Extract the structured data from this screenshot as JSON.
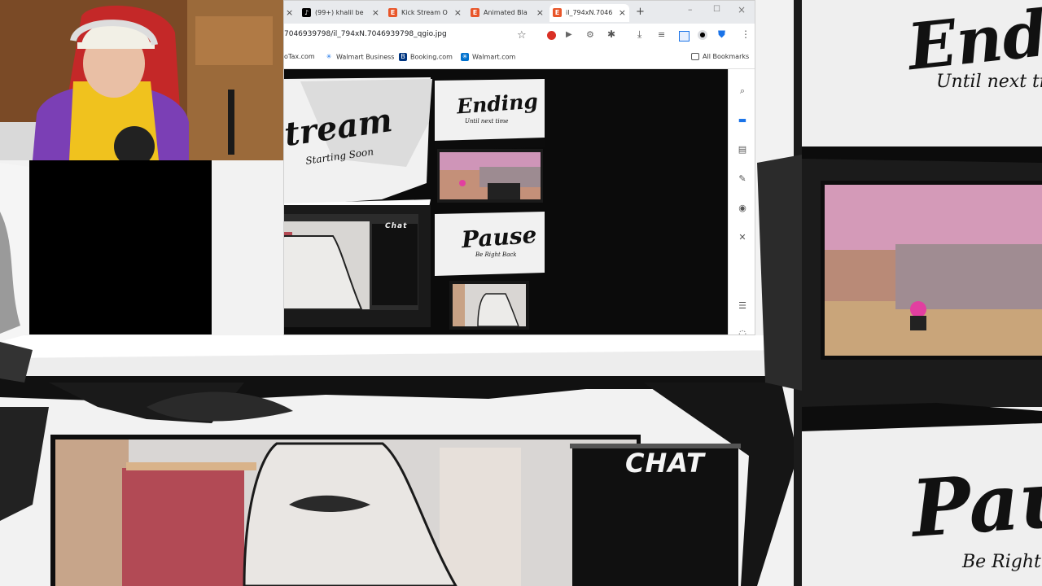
{
  "browser": {
    "tabs": [
      {
        "label": "(99+) khalil be",
        "favicon": "tiktok-icon",
        "favicon_color": "#000000"
      },
      {
        "label": "Kick Stream O",
        "favicon": "etsy-icon",
        "favicon_color": "#e8562a"
      },
      {
        "label": "Animated Bla",
        "favicon": "etsy-icon",
        "favicon_color": "#e8562a"
      },
      {
        "label": "il_794xN.7046",
        "favicon": "etsy-icon",
        "favicon_color": "#e8562a"
      }
    ],
    "new_tab": "+",
    "url": "7046939798/il_794xN.7046939798_qgio.jpg",
    "bookmarks": [
      "oTax.com",
      "Walmart Business",
      "Booking.com",
      "Walmart.com"
    ],
    "all_bookmarks": "All Bookmarks"
  },
  "overlay_preview": {
    "stream_title": "tream",
    "stream_sub": "Starting Soon",
    "ending_title": "Ending",
    "ending_sub": "Until next time",
    "pause_title": "Pause",
    "pause_sub": "Be Right Back",
    "chat_label": "Chat"
  },
  "background_overlay": {
    "ending_title": "Endin",
    "ending_sub": "Until next tim",
    "pause_title": "Paus",
    "pause_sub": "Be Right",
    "chat_label": "CHAT"
  },
  "colors": {
    "accent_blue": "#1a73e8",
    "etsy_orange": "#e8562a",
    "ink": "#111111"
  }
}
